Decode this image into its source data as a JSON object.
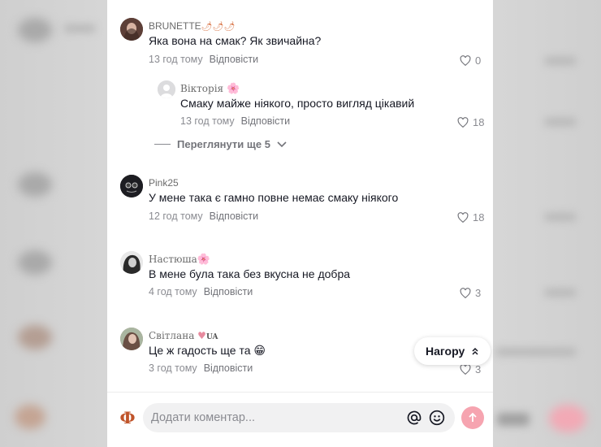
{
  "comments": [
    {
      "username": "BRUNETTE",
      "username_suffix": "🌶🌶🌶",
      "text": "Яка вона на смак? Як звичайна?",
      "time": "13 год тому",
      "reply_label": "Відповісти",
      "likes": "0"
    },
    {
      "username": "Вікторія",
      "username_suffix": "🌸",
      "text": "Смаку майже ніякого, просто вигляд цікавий",
      "time": "13 год тому",
      "reply_label": "Відповісти",
      "likes": "18"
    },
    {
      "username": "Pink25",
      "username_suffix": "",
      "text": "У мене така є гамно повне немає смаку ніякого",
      "time": "12 год тому",
      "reply_label": "Відповісти",
      "likes": "18"
    },
    {
      "username": "Настюша",
      "username_suffix": "🌸",
      "text": "В мене була така без вкусна не добра",
      "time": "4 год тому",
      "reply_label": "Відповісти",
      "likes": "3"
    },
    {
      "username": "Світлана",
      "username_suffix": "♥",
      "username_badge": "UA",
      "text": "Це ж гадость ще та 😁",
      "time": "3 год тому",
      "reply_label": "Відповісти",
      "likes": "3"
    }
  ],
  "view_more": {
    "label": "Переглянути ще 5"
  },
  "top_button": {
    "label": "Нагору"
  },
  "composer": {
    "placeholder": "Додати коментар...",
    "avatar_letter": "Ф"
  },
  "colors": {
    "send": "#f6a4b0",
    "accent_pink": "#fe2c55"
  },
  "icons": [
    "heart-icon",
    "chevron-down-icon",
    "double-chevron-up-icon",
    "at-icon",
    "emoji-icon",
    "arrow-up-icon"
  ]
}
